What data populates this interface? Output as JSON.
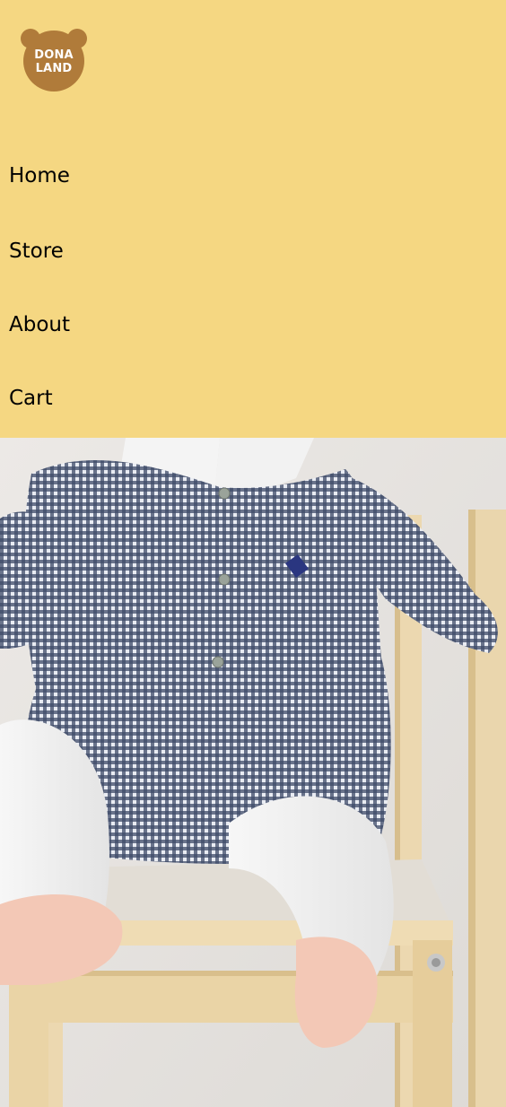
{
  "logo": {
    "line1": "DONA",
    "line2": "LAND"
  },
  "nav": {
    "home": "Home",
    "store": "Store",
    "about": "About",
    "cart": "Cart"
  },
  "colors": {
    "header_background": "#F5D782",
    "logo_brown": "#B07B3A",
    "nav_text": "#000000"
  },
  "hero": {
    "icon": "photo-baby-in-gingham-dress-on-wooden-chair"
  }
}
